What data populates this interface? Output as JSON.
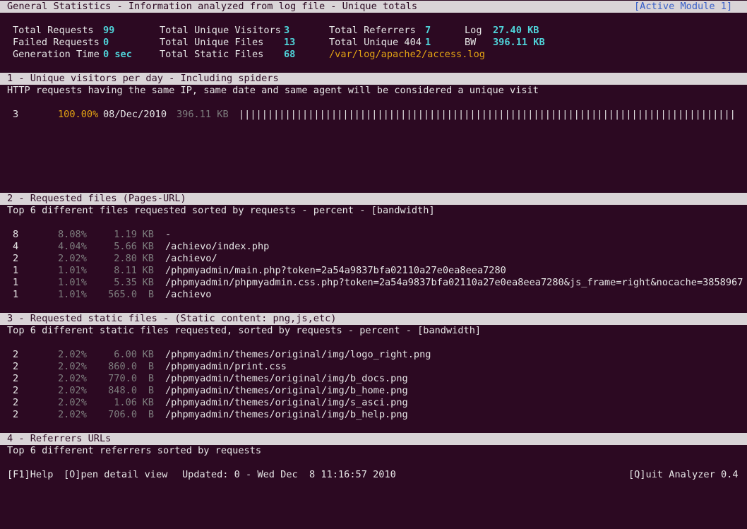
{
  "header": {
    "title": "General Statistics - Information analyzed from log file - Unique totals",
    "active_module": "[Active Module 1]"
  },
  "general": {
    "total_requests_label": "Total Requests",
    "total_requests": "99",
    "failed_requests_label": "Failed Requests",
    "failed_requests": "0",
    "generation_time_label": "Generation Time",
    "generation_time": "0 sec",
    "unique_visitors_label": "Total Unique Visitors",
    "unique_visitors": "3",
    "unique_files_label": "Total Unique Files",
    "unique_files": "13",
    "static_files_label": "Total Static Files",
    "static_files": "68",
    "referrers_label": "Total Referrers",
    "referrers": "7",
    "unique_404_label": "Total Unique 404",
    "unique_404": "1",
    "log_label": "Log",
    "log_size": "27.40 KB",
    "bw_label": "BW",
    "bw": "396.11 KB",
    "log_path": "/var/log/apache2/access.log"
  },
  "module1": {
    "title": "1 - Unique visitors per day - Including spiders",
    "description": "HTTP requests having the same IP, same date and same agent will be considered a unique visit",
    "rows": [
      {
        "count": "3",
        "percent": "100.00%",
        "date": "08/Dec/2010",
        "bandwidth": "396.11 KB",
        "graph": "||||||||||||||||||||||||||||||||||||||||||||||||||||||||||||||||||||||||||||||||||||||||"
      }
    ]
  },
  "module2": {
    "title": "2 - Requested files (Pages-URL)",
    "description": "Top 6 different files requested sorted by requests - percent - [bandwidth]",
    "rows": [
      {
        "count": "8",
        "percent": "8.08%",
        "size": "1.19",
        "unit": "KB",
        "path": "-"
      },
      {
        "count": "4",
        "percent": "4.04%",
        "size": "5.66",
        "unit": "KB",
        "path": "/achievo/index.php"
      },
      {
        "count": "2",
        "percent": "2.02%",
        "size": "2.80",
        "unit": "KB",
        "path": "/achievo/"
      },
      {
        "count": "1",
        "percent": "1.01%",
        "size": "8.11",
        "unit": "KB",
        "path": "/phpmyadmin/main.php?token=2a54a9837bfa02110a27e0ea8eea7280"
      },
      {
        "count": "1",
        "percent": "1.01%",
        "size": "5.35",
        "unit": "KB",
        "path": "/phpmyadmin/phpmyadmin.css.php?token=2a54a9837bfa02110a27e0ea8eea7280&js_frame=right&nocache=3858967"
      },
      {
        "count": "1",
        "percent": "1.01%",
        "size": "565.0",
        "unit": "B",
        "path": "/achievo"
      }
    ]
  },
  "module3": {
    "title": "3 - Requested static files - (Static content: png,js,etc)",
    "description": "Top 6 different static files requested, sorted by requests - percent - [bandwidth]",
    "rows": [
      {
        "count": "2",
        "percent": "2.02%",
        "size": "6.00",
        "unit": "KB",
        "path": "/phpmyadmin/themes/original/img/logo_right.png"
      },
      {
        "count": "2",
        "percent": "2.02%",
        "size": "860.0",
        "unit": "B",
        "path": "/phpmyadmin/print.css"
      },
      {
        "count": "2",
        "percent": "2.02%",
        "size": "770.0",
        "unit": "B",
        "path": "/phpmyadmin/themes/original/img/b_docs.png"
      },
      {
        "count": "2",
        "percent": "2.02%",
        "size": "848.0",
        "unit": "B",
        "path": "/phpmyadmin/themes/original/img/b_home.png"
      },
      {
        "count": "2",
        "percent": "2.02%",
        "size": "1.06",
        "unit": "KB",
        "path": "/phpmyadmin/themes/original/img/s_asci.png"
      },
      {
        "count": "2",
        "percent": "2.02%",
        "size": "706.0",
        "unit": "B",
        "path": "/phpmyadmin/themes/original/img/b_help.png"
      }
    ]
  },
  "module4": {
    "title": "4 - Referrers URLs",
    "description": "Top 6 different referrers sorted by requests"
  },
  "footer": {
    "help": "[F1]Help",
    "open_detail": "[O]pen detail view",
    "updated": "Updated: 0 - Wed Dec  8 11:16:57 2010",
    "quit": "[Q]uit Analyzer 0.4"
  },
  "colors": {
    "background": "#2c0922",
    "header_bar": "#d9d4d7",
    "value_cyan": "#4fd3d9",
    "accent_orange": "#e3a313",
    "muted_gray": "#7d7d7d",
    "active_module_blue": "#3960c8"
  }
}
